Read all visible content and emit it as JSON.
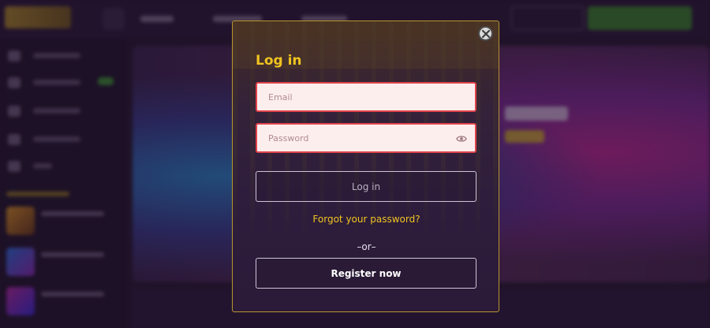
{
  "modal": {
    "title": "Log in",
    "email": {
      "placeholder": "Email",
      "value": ""
    },
    "password": {
      "placeholder": "Password",
      "value": ""
    },
    "login_button": "Log in",
    "forgot_link": "Forgot your password?",
    "divider": "–or–",
    "register_button": "Register now",
    "icons": {
      "close": "close-icon",
      "show_password": "eye-icon"
    }
  },
  "colors": {
    "accent_gold": "#f0c420",
    "field_error_border": "#e0434a",
    "field_background": "#fdeeee",
    "modal_border": "#b8962e",
    "background": "#2a1a33"
  }
}
